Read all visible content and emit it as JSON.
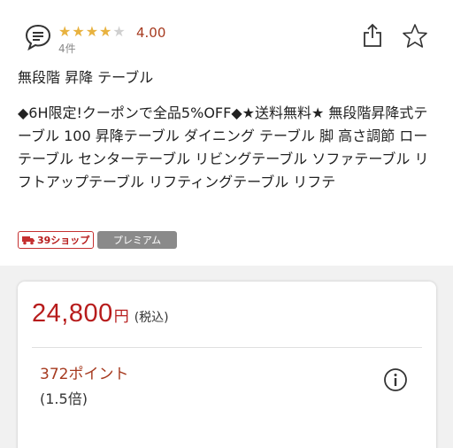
{
  "review": {
    "stars_filled": 4,
    "stars_total": 5,
    "rating": "4.00",
    "count": "4件"
  },
  "icons": {
    "review": "chat-bubble-icon",
    "share": "share-icon",
    "favorite": "star-outline-icon",
    "info": "info-icon",
    "truck": "truck-icon"
  },
  "product": {
    "short_title": "無段階 昇降 テーブル",
    "description": "◆6H限定!クーポンで全品5%OFF◆★送料無料★ 無段階昇降式テーブル 100 昇降テーブル ダイニング テーブル 脚 高さ調節 ローテーブル センターテーブル リビングテーブル ソファテーブル リフトアップテーブル リフティングテーブル リフテ"
  },
  "badges": {
    "shop": "39ショップ",
    "premium": "プレミアム"
  },
  "price": {
    "amount": "24,800",
    "currency": "円",
    "tax_note": "(税込)",
    "points": "372ポイント",
    "points_rate": "(1.5倍)"
  },
  "colors": {
    "accent_red": "#b71c1c",
    "rating_text": "#a63a1f",
    "star_filled": "#e8b23f",
    "star_empty": "#d0d0d0",
    "premium_bg": "#8a8a8a"
  }
}
